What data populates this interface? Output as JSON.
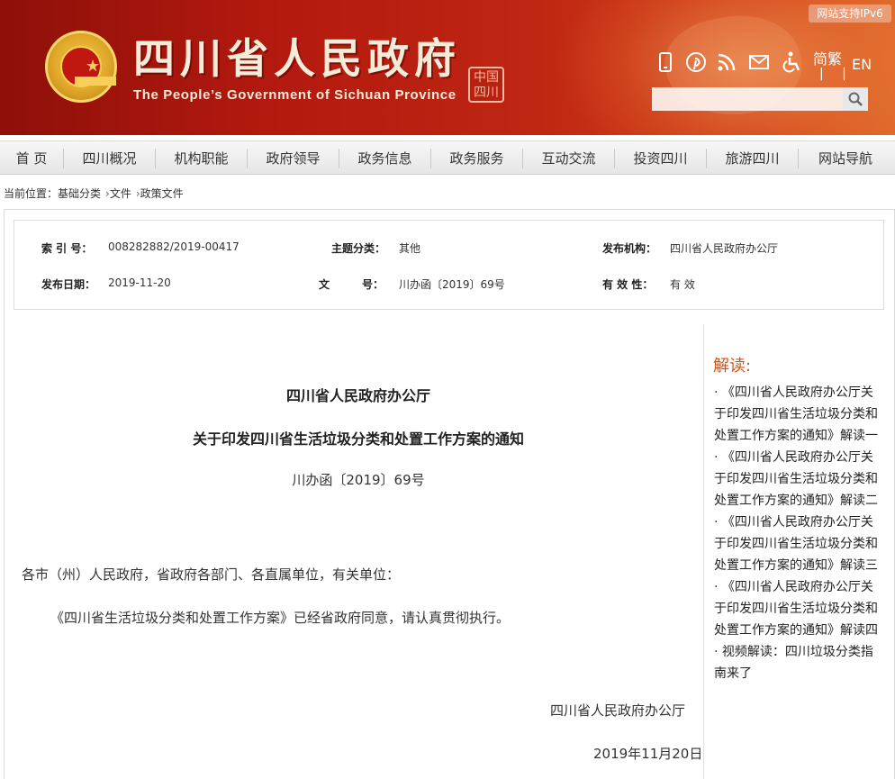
{
  "header": {
    "title": "四川省人民政府",
    "subtitle": "The People’s Government of Sichuan Province",
    "seal_text": "中国四川",
    "ipv6_badge": "网站支持IPv6",
    "lang_simp": "简繁",
    "lang_sep": "| |",
    "lang_en": "EN",
    "search_placeholder": "",
    "icons": [
      "mobile-icon",
      "pinterest-icon",
      "rss-icon",
      "mail-icon",
      "accessibility-icon"
    ],
    "colors": {
      "banner_dark": "#8e1009",
      "banner_light": "#e06a2c"
    }
  },
  "nav": {
    "items": [
      {
        "label": "首 页"
      },
      {
        "label": "四川概况"
      },
      {
        "label": "机构职能"
      },
      {
        "label": "政府领导"
      },
      {
        "label": "政务信息"
      },
      {
        "label": "政务服务"
      },
      {
        "label": "互动交流"
      },
      {
        "label": "投资四川"
      },
      {
        "label": "旅游四川"
      },
      {
        "label": "网站导航"
      }
    ]
  },
  "breadcrumb": {
    "prefix": "当前位置：",
    "items": [
      "基础分类",
      "文件",
      "政策文件"
    ],
    "separator": "›"
  },
  "meta": {
    "index_label": "索 引 号：",
    "index_value": "008282882/2019-00417",
    "category_label": "主题分类：",
    "category_value": "其他",
    "publisher_label": "发布机构：",
    "publisher_value": "四川省人民政府办公厅",
    "date_label": "发布日期：",
    "date_value": "2019-11-20",
    "docno_label": "文　　　号：",
    "docno_value": "川办函〔2019〕69号",
    "validity_label": "有 效 性：",
    "validity_value": "有 效"
  },
  "article": {
    "org": "四川省人民政府办公厅",
    "title": "关于印发四川省生活垃圾分类和处置工作方案的通知",
    "doc_number": "川办函〔2019〕69号",
    "recipients": "各市（州）人民政府，省政府各部门、各直属单位，有关单位：",
    "body": "《四川省生活垃圾分类和处置工作方案》已经省政府同意，请认真贯彻执行。",
    "sign_org": "四川省人民政府办公厅",
    "sign_date": "2019年11月20日"
  },
  "sidebar": {
    "heading": "解读:",
    "items": [
      {
        "text": "· 《四川省人民政府办公厅关于印发四川省生活垃圾分类和处置工作方案的通知》解读一"
      },
      {
        "text": "· 《四川省人民政府办公厅关于印发四川省生活垃圾分类和处置工作方案的通知》解读二"
      },
      {
        "text": "· 《四川省人民政府办公厅关于印发四川省生活垃圾分类和处置工作方案的通知》解读三"
      },
      {
        "text": "· 《四川省人民政府办公厅关于印发四川省生活垃圾分类和处置工作方案的通知》解读四"
      },
      {
        "text": "· 视频解读：四川垃圾分类指南来了"
      }
    ],
    "accent_color": "#d2531a"
  }
}
